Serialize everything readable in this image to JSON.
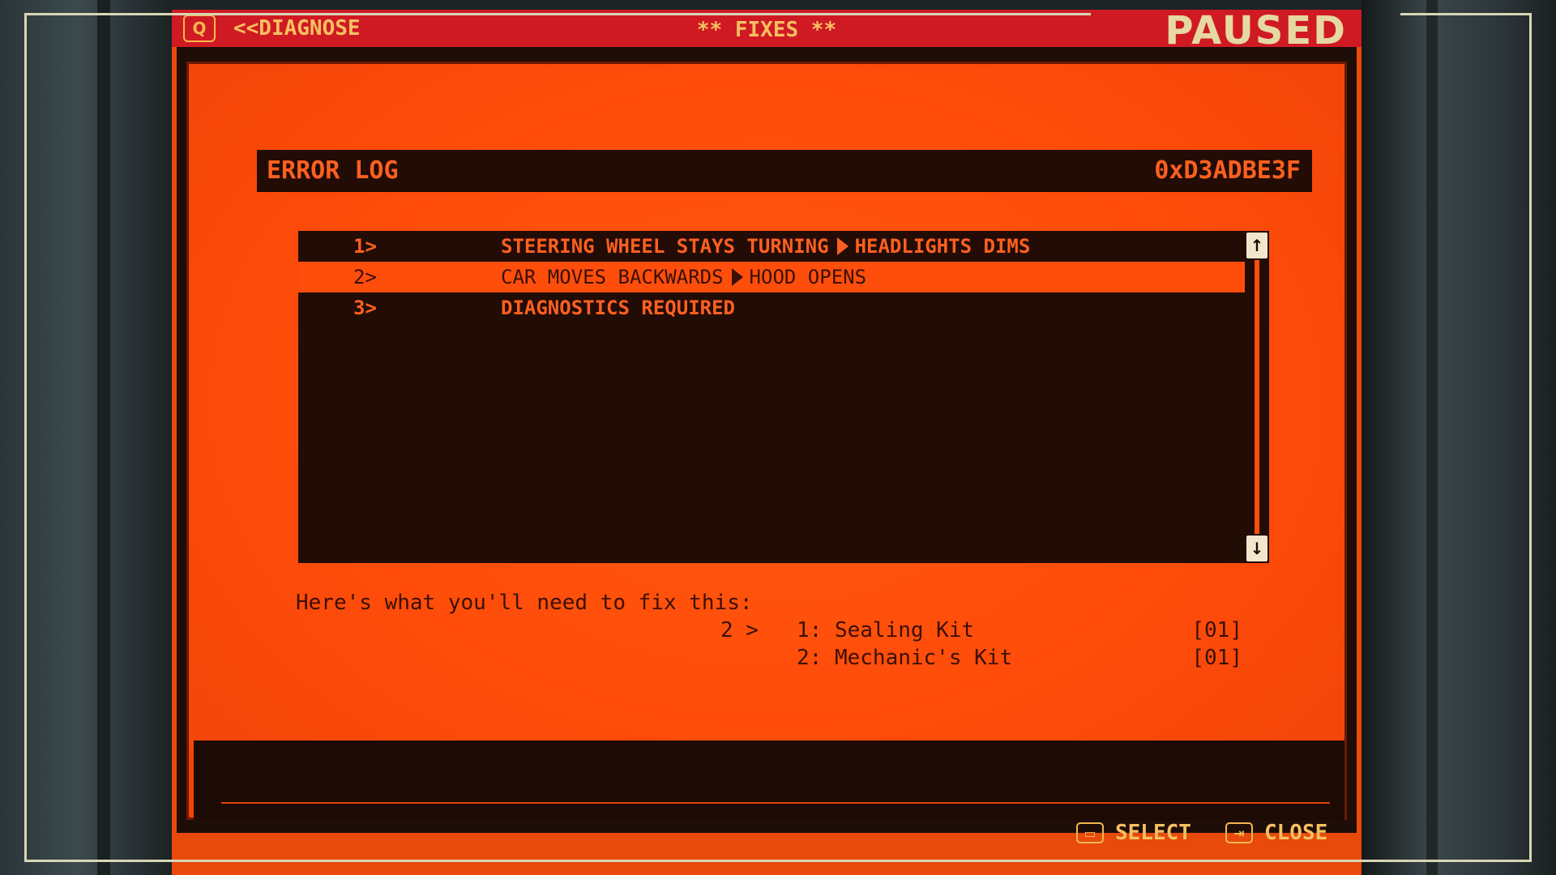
{
  "topbar": {
    "search_key": "Q",
    "back_label": "<<DIAGNOSE",
    "title": "** FIXES **",
    "status": "PAUSED"
  },
  "error_log": {
    "title": "ERROR LOG",
    "code": "0xD3ADBE3F",
    "items": [
      {
        "num": "1>",
        "cause": "STEERING WHEEL STAYS TURNING",
        "effect": "HEADLIGHTS DIMS"
      },
      {
        "num": "2>",
        "cause": "CAR MOVES BACKWARDS",
        "effect": "HOOD OPENS"
      },
      {
        "num": "3>",
        "cause": "DIAGNOSTICS REQUIRED",
        "effect": ""
      }
    ]
  },
  "requirements": {
    "label": "Here's what you'll need to fix this:",
    "for_item": "2 >",
    "items": [
      {
        "name": "1: Sealing Kit",
        "qty": "[01]"
      },
      {
        "name": "2: Mechanic's Kit",
        "qty": "[01]"
      }
    ]
  },
  "footer": {
    "select_label": "SELECT",
    "close_label": "CLOSE"
  },
  "colors": {
    "screen_orange": "#ff4e0c",
    "topbar_red": "#cf1a24",
    "panel_dark": "#230c06",
    "highlight_text": "#ff6020",
    "accent_yellow": "#f7c060"
  }
}
